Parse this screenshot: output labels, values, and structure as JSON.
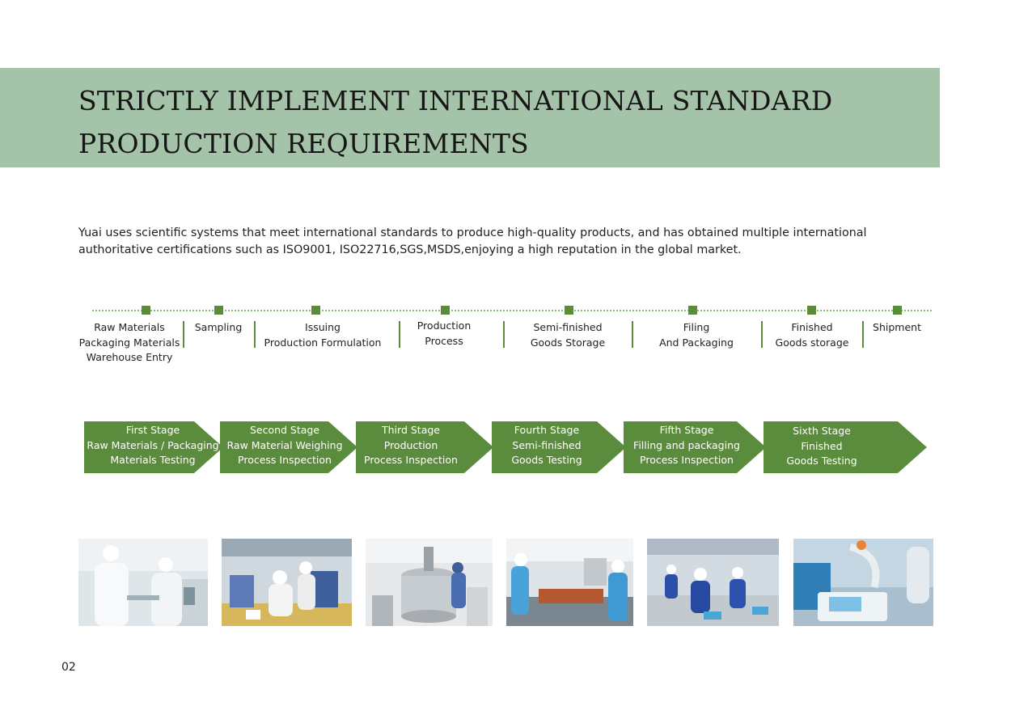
{
  "header": {
    "title": "STRICTLY IMPLEMENT INTERNATIONAL STANDARD PRODUCTION REQUIREMENTS"
  },
  "intro": {
    "text": "Yuai uses scientific systems that meet international standards to produce high-quality products, and has obtained multiple international authoritative certifications such as ISO9001, ISO22716,SGS,MSDS,enjoying a high reputation in the global market."
  },
  "timeline": {
    "steps": [
      {
        "label": "Raw Materials\nPackaging Materials\nWarehouse Entry"
      },
      {
        "label": "Sampling"
      },
      {
        "label": "Issuing\nProduction Formulation"
      },
      {
        "label": "Production\nProcess"
      },
      {
        "label": "Semi-finished\nGoods Storage"
      },
      {
        "label": "Filing\nAnd Packaging"
      },
      {
        "label": "Finished\nGoods storage"
      },
      {
        "label": "Shipment"
      }
    ]
  },
  "stages": [
    {
      "label": "First Stage\nRaw Materials / Packaging\nMaterials Testing"
    },
    {
      "label": "Second Stage\nRaw Material Weighing\nProcess Inspection"
    },
    {
      "label": "Third Stage\nProduction\nProcess Inspection"
    },
    {
      "label": "Fourth Stage\nSemi-finished\nGoods Testing"
    },
    {
      "label": "Fifth Stage\nFilling and packaging\nProcess Inspection"
    },
    {
      "label": "Sixth  Stage\nFinished\nGoods Testing"
    }
  ],
  "colors": {
    "banner": "#a4c3a8",
    "accent": "#5b8c3e"
  },
  "footer": {
    "page_number": "02"
  }
}
